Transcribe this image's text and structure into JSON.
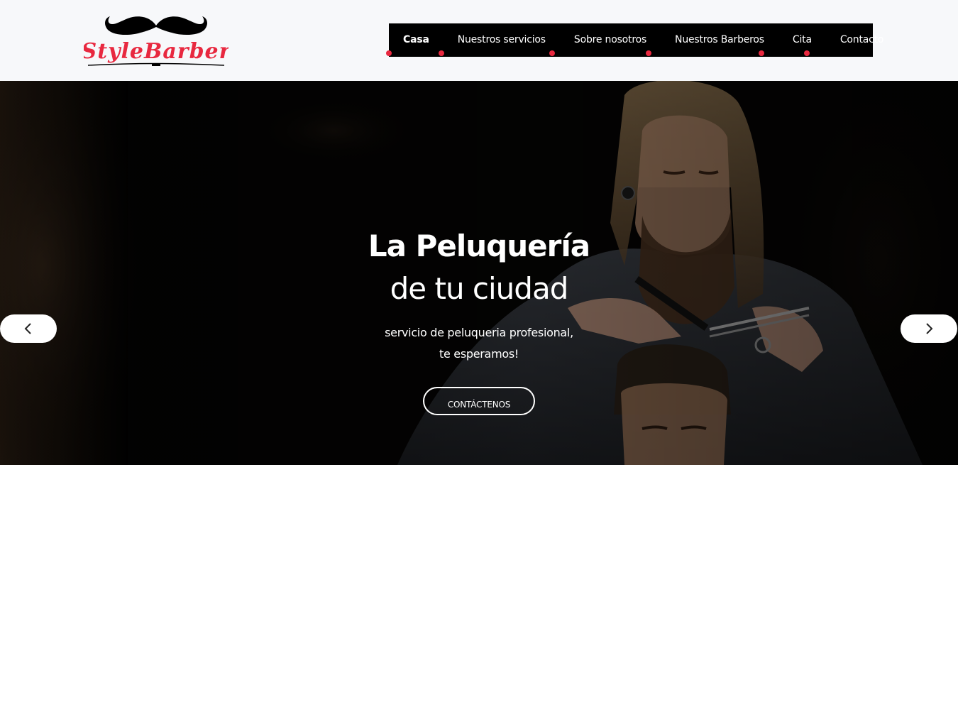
{
  "logo": {
    "text": "StyleBarber",
    "icon": "mustache-icon",
    "accent": "#e8283f"
  },
  "nav": {
    "items": [
      {
        "label": "Casa",
        "active": true
      },
      {
        "label": "Nuestros servicios",
        "active": false
      },
      {
        "label": "Sobre nosotros",
        "active": false
      },
      {
        "label": "Nuestros Barberos",
        "active": false
      },
      {
        "label": "Cita",
        "active": false
      },
      {
        "label": "Contacto",
        "active": false
      }
    ]
  },
  "hero": {
    "title_line1": "La Peluquería",
    "title_line2": "de tu ciudad",
    "subtitle_line1": "servicio de peluqueria profesional,",
    "subtitle_line2": "te esperamos!",
    "cta_label": "CONTÁCTENOS",
    "prev_icon": "chevron-left-icon",
    "next_icon": "chevron-right-icon"
  },
  "colors": {
    "header_bg": "#f7f8fa",
    "nav_bg": "#000000",
    "accent": "#e8283f",
    "hero_text": "#ffffff"
  }
}
